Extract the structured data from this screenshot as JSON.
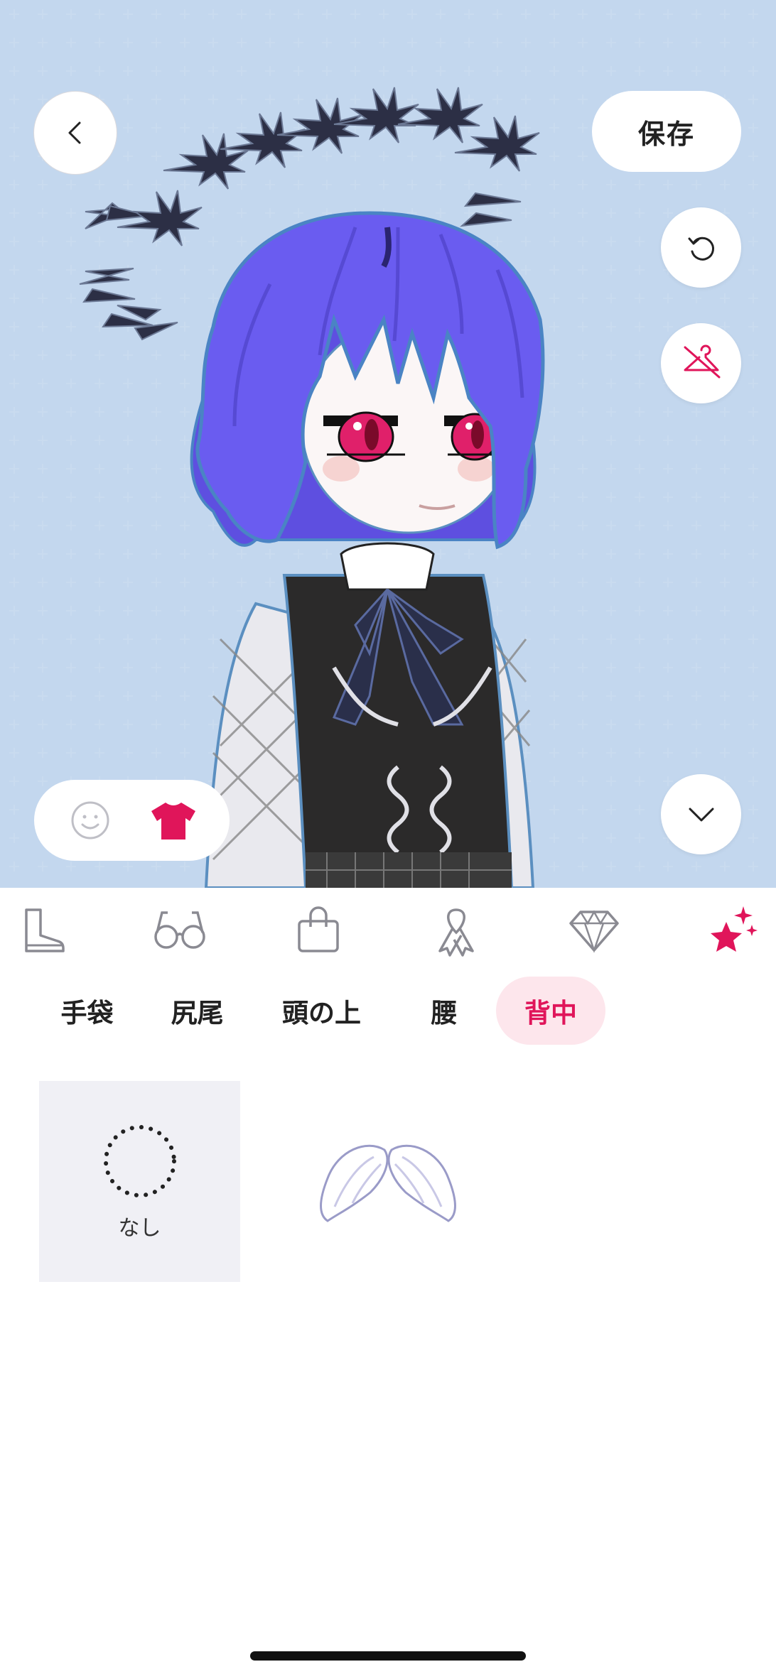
{
  "header": {
    "back_icon": "chevron-left-icon",
    "save_label": "保存"
  },
  "preview_controls": {
    "undo_icon": "undo-icon",
    "hide_outfit_icon": "hanger-off-icon",
    "collapse_icon": "chevron-down-icon",
    "mode_toggle": [
      {
        "icon": "face-icon",
        "active": false
      },
      {
        "icon": "shirt-icon",
        "active": true
      }
    ]
  },
  "categories": [
    {
      "icon": "boot-icon",
      "active": false
    },
    {
      "icon": "glasses-icon",
      "active": false
    },
    {
      "icon": "bag-icon",
      "active": false
    },
    {
      "icon": "ribbon-icon",
      "active": false
    },
    {
      "icon": "gem-icon",
      "active": false
    },
    {
      "icon": "sparkle-stars-icon",
      "active": true
    }
  ],
  "subtabs": [
    {
      "label": "手袋",
      "active": false
    },
    {
      "label": "尻尾",
      "active": false
    },
    {
      "label": "頭の上",
      "active": false
    },
    {
      "label": "腰",
      "active": false
    },
    {
      "label": "背中",
      "active": true
    }
  ],
  "items": [
    {
      "label": "なし",
      "icon": "none-dotted-circle-icon",
      "selected": true
    },
    {
      "label": "",
      "icon": "angel-wings-icon",
      "selected": false
    }
  ],
  "colors": {
    "accent": "#e0155a",
    "accent_soft": "#fde6ec",
    "preview_bg": "#f3f4f9",
    "grid_plus": "#c9dbef",
    "hair": "#6a5cf0"
  }
}
